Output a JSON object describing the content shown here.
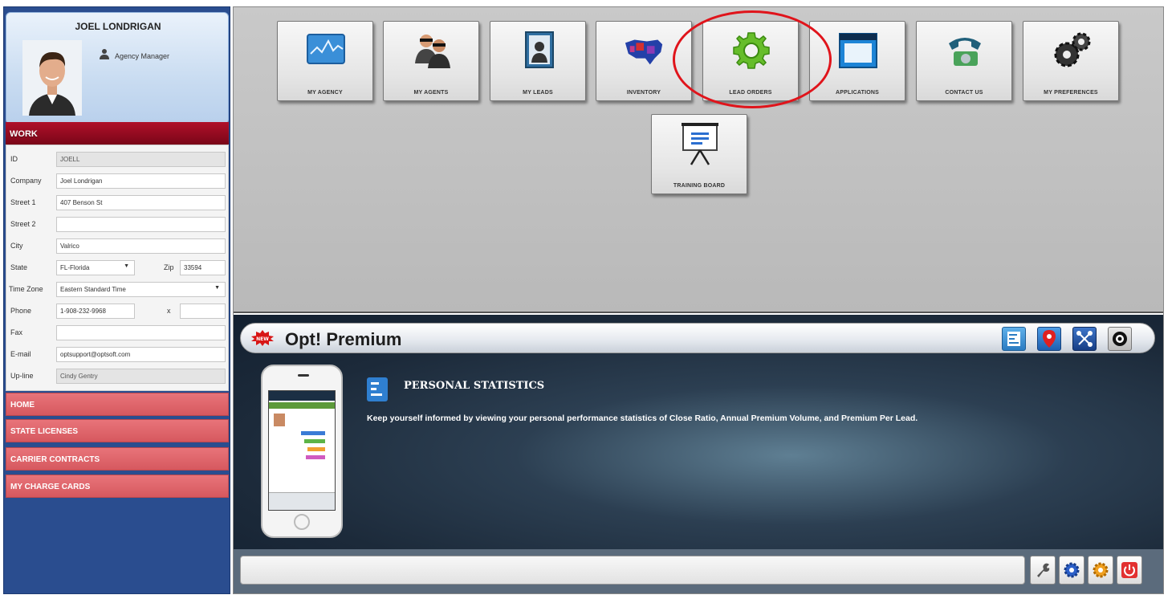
{
  "profile": {
    "name": "JOEL LONDRIGAN",
    "role": "Agency Manager"
  },
  "work": {
    "header": "WORK",
    "fields": {
      "id": {
        "label": "ID",
        "value": "JOELL"
      },
      "company": {
        "label": "Company",
        "value": "Joel Londrigan"
      },
      "street1": {
        "label": "Street 1",
        "value": "407 Benson St"
      },
      "street2": {
        "label": "Street 2",
        "value": ""
      },
      "city": {
        "label": "City",
        "value": "Valrico"
      },
      "state": {
        "label": "State",
        "value": "FL-Florida"
      },
      "zip": {
        "label": "Zip",
        "value": "33594"
      },
      "timezone": {
        "label": "Time Zone",
        "value": "Eastern Standard Time"
      },
      "phone": {
        "label": "Phone",
        "value": "1-908-232-9968",
        "ext_label": "x",
        "ext_value": ""
      },
      "fax": {
        "label": "Fax",
        "value": ""
      },
      "email": {
        "label": "E-mail",
        "value": "optsupport@optsoft.com"
      },
      "upline": {
        "label": "Up-line",
        "value": "Cindy Gentry"
      }
    }
  },
  "nav": [
    "HOME",
    "STATE LICENSES",
    "CARRIER CONTRACTS",
    "MY CHARGE CARDS"
  ],
  "tiles": [
    {
      "label": "MY AGENCY",
      "icon": "chart-monitor-icon"
    },
    {
      "label": "MY AGENTS",
      "icon": "agents-icon"
    },
    {
      "label": "MY LEADS",
      "icon": "leads-book-icon"
    },
    {
      "label": "INVENTORY",
      "icon": "usa-map-icon"
    },
    {
      "label": "LEAD ORDERS",
      "icon": "green-gear-icon"
    },
    {
      "label": "APPLICATIONS",
      "icon": "app-window-icon"
    },
    {
      "label": "CONTACT US",
      "icon": "telephone-icon"
    },
    {
      "label": "MY PREFERENCES",
      "icon": "gears-icon"
    },
    {
      "label": "TRAINING BOARD",
      "icon": "presentation-board-icon"
    }
  ],
  "premium": {
    "badge": "NEW",
    "title": "Opt! Premium",
    "feature_title": "PERSONAL STATISTICS",
    "feature_desc": "Keep yourself informed by viewing your personal performance statistics of Close Ratio, Annual Premium Volume, and Premium Per Lead.",
    "buttons": [
      "statistics-icon",
      "map-pin-icon",
      "network-icon",
      "target-icon"
    ]
  },
  "bottom_buttons": [
    "wrench-icon",
    "blue-gear-icon",
    "orange-gear-icon",
    "power-icon"
  ],
  "colors": {
    "work_header": "#9a0c22",
    "nav_button": "#de646a",
    "sidebar": "#2a4d8f",
    "highlight": "#e0141b"
  }
}
